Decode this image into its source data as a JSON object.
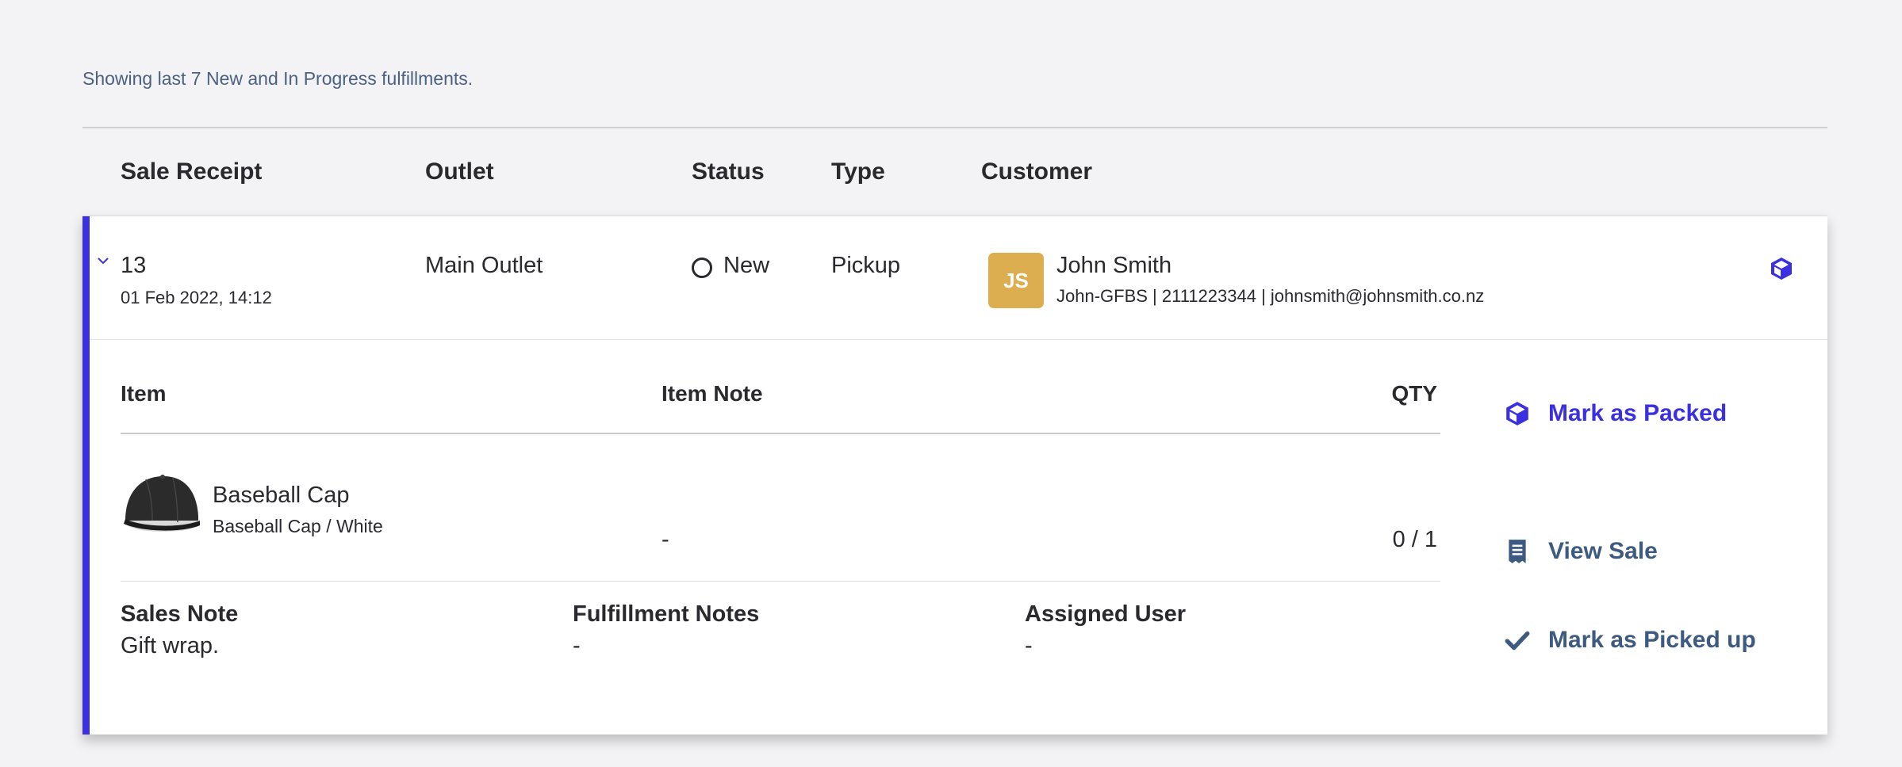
{
  "summary": "Showing last 7 New and In Progress fulfillments.",
  "columns": {
    "sale_receipt": "Sale Receipt",
    "outlet": "Outlet",
    "status": "Status",
    "type": "Type",
    "customer": "Customer"
  },
  "fulfillment": {
    "receipt_number": "13",
    "date": "01 Feb 2022, 14:12",
    "outlet": "Main Outlet",
    "status": "New",
    "type": "Pickup",
    "customer": {
      "initials": "JS",
      "name": "John Smith",
      "details": "John-GFBS | 2111223344 | johnsmith@johnsmith.co.nz",
      "avatar_color": "#dcae4f"
    },
    "items_header": {
      "item": "Item",
      "item_note": "Item Note",
      "qty": "QTY"
    },
    "items": [
      {
        "name": "Baseball Cap",
        "variant": "Baseball Cap / White",
        "note": "-",
        "qty": "0 / 1"
      }
    ],
    "notes": {
      "sales_note_label": "Sales Note",
      "sales_note": "Gift wrap.",
      "fulfillment_notes_label": "Fulfillment Notes",
      "fulfillment_notes": "-",
      "assigned_user_label": "Assigned User",
      "assigned_user": "-"
    },
    "actions": {
      "mark_packed": "Mark as Packed",
      "view_sale": "View Sale",
      "mark_picked_up": "Mark as Picked up"
    }
  },
  "colors": {
    "accent": "#3b30e0",
    "secondary_action": "#3d5a80",
    "summary_text": "#4a6180"
  },
  "icons": [
    "chevron-down-icon",
    "box-icon",
    "receipt-icon",
    "checkmark-icon",
    "status-ring-icon"
  ]
}
